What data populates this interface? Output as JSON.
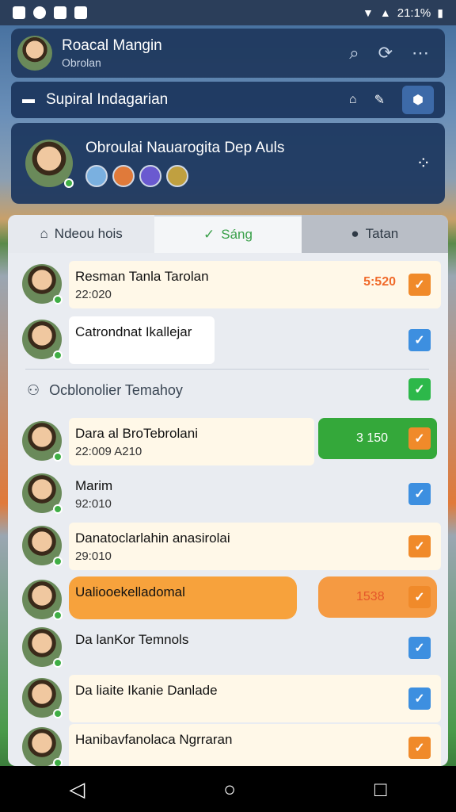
{
  "status": {
    "time": "21:1%"
  },
  "appbar": {
    "title": "Roacal Mangin",
    "subtitle": "Obrolan",
    "search_icon": "search-icon",
    "refresh_icon": "refresh-icon",
    "more_icon": "more-icon"
  },
  "subbar": {
    "label": "Supiral Indagarian"
  },
  "profile": {
    "name": "Obroulai Nauarogita Dep Auls"
  },
  "tabs": [
    {
      "label": "Ndeou hois"
    },
    {
      "label": "Sáng"
    },
    {
      "label": "Tatan"
    }
  ],
  "rows": [
    {
      "name": "Resman Tanla Tarolan",
      "time": "22:020",
      "amount": "5:520",
      "check": "orange"
    },
    {
      "name": "Catrondnat Ikallejar",
      "time": "",
      "amount": "",
      "check": "blue"
    },
    {
      "name": "Dara al BroTebrolani",
      "time": "22:009 A210",
      "amount": "3 150",
      "check": "orange"
    },
    {
      "name": "Marim",
      "time": "92:010",
      "amount": "",
      "check": "blue"
    },
    {
      "name": "Danatoclarlahin anasirolai",
      "time": "29:010",
      "amount": "",
      "check": "orange"
    },
    {
      "name": "Ualiooekelladomal",
      "time": "",
      "amount": "1538",
      "check": "orange"
    },
    {
      "name": "Da lanKor Temnols",
      "time": "",
      "amount": "",
      "check": "blue"
    },
    {
      "name": "Da liaite Ikanie Danlade",
      "time": "",
      "amount": "",
      "check": "blue"
    },
    {
      "name": "Hanibavfanolaca Ngrraran",
      "time": "",
      "amount": "",
      "check": "orange"
    }
  ],
  "section": {
    "label": "Ocblonolier Temahoy"
  }
}
